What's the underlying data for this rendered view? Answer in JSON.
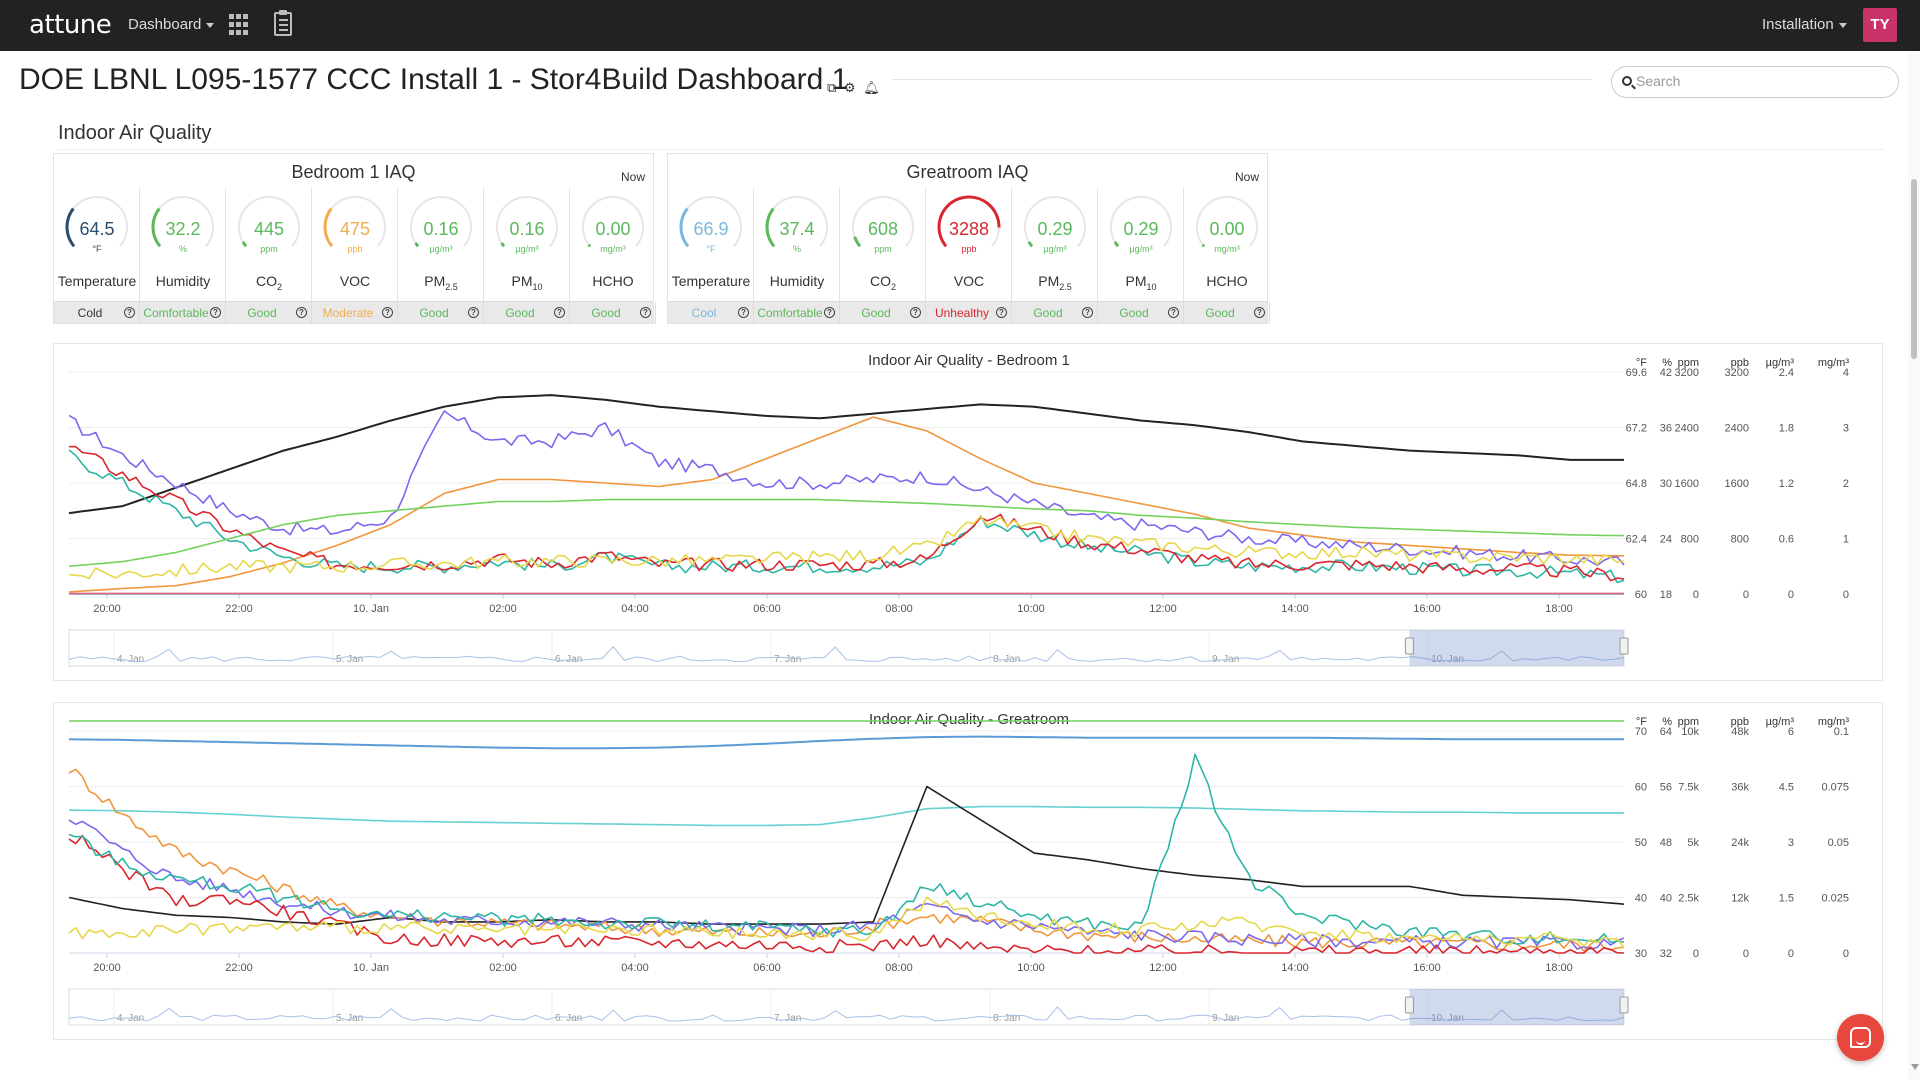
{
  "topbar": {
    "brand": "attune",
    "dashboard_menu": "Dashboard",
    "installation_menu": "Installation",
    "avatar_initials": "TY"
  },
  "page": {
    "title": "DOE LBNL L095-1577 CCC Install 1 - Stor4Build Dashboard 1",
    "search_placeholder": "Search",
    "section_title": "Indoor Air Quality"
  },
  "panels": [
    {
      "title": "Bedroom 1 IAQ",
      "now": "Now",
      "tiles": [
        {
          "value": "64.5",
          "unit": "°F",
          "label": "Temperature",
          "sub": "",
          "status": "Cold",
          "color": "#2c4d6c",
          "fraction": 0.3
        },
        {
          "value": "32.2",
          "unit": "%",
          "label": "Humidity",
          "sub": "",
          "status": "Comfortable",
          "color": "#5cb85c",
          "fraction": 0.3
        },
        {
          "value": "445",
          "unit": "ppm",
          "label": "CO",
          "sub": "2",
          "status": "Good",
          "color": "#5cb85c",
          "fraction": 0.04
        },
        {
          "value": "475",
          "unit": "ppb",
          "label": "VOC",
          "sub": "",
          "status": "Moderate",
          "color": "#f0ad4e",
          "fraction": 0.3
        },
        {
          "value": "0.16",
          "unit": "µg/m³",
          "label": "PM",
          "sub": "2.5",
          "status": "Good",
          "color": "#5cb85c",
          "fraction": 0.03
        },
        {
          "value": "0.16",
          "unit": "µg/m³",
          "label": "PM",
          "sub": "10",
          "status": "Good",
          "color": "#5cb85c",
          "fraction": 0.03
        },
        {
          "value": "0.00",
          "unit": "mg/m³",
          "label": "HCHO",
          "sub": "",
          "status": "Good",
          "color": "#5cb85c",
          "fraction": 0.0
        }
      ]
    },
    {
      "title": "Greatroom IAQ",
      "now": "Now",
      "tiles": [
        {
          "value": "66.9",
          "unit": "°F",
          "label": "Temperature",
          "sub": "",
          "status": "Cool",
          "color": "#7ab8dd",
          "fraction": 0.3
        },
        {
          "value": "37.4",
          "unit": "%",
          "label": "Humidity",
          "sub": "",
          "status": "Comfortable",
          "color": "#5cb85c",
          "fraction": 0.3
        },
        {
          "value": "608",
          "unit": "ppm",
          "label": "CO",
          "sub": "2",
          "status": "Good",
          "color": "#5cb85c",
          "fraction": 0.08
        },
        {
          "value": "3288",
          "unit": "ppb",
          "label": "VOC",
          "sub": "",
          "status": "Unhealthy",
          "color": "#d9262f",
          "fraction": 0.85
        },
        {
          "value": "0.29",
          "unit": "µg/m³",
          "label": "PM",
          "sub": "2.5",
          "status": "Good",
          "color": "#5cb85c",
          "fraction": 0.04
        },
        {
          "value": "0.29",
          "unit": "µg/m³",
          "label": "PM",
          "sub": "10",
          "status": "Good",
          "color": "#5cb85c",
          "fraction": 0.04
        },
        {
          "value": "0.00",
          "unit": "mg/m³",
          "label": "HCHO",
          "sub": "",
          "status": "Good",
          "color": "#5cb85c",
          "fraction": 0.0
        }
      ]
    }
  ],
  "chart_data": [
    {
      "type": "line",
      "title": "Indoor Air Quality - Bedroom 1",
      "x_ticks": [
        "20:00",
        "22:00",
        "10. Jan",
        "02:00",
        "04:00",
        "06:00",
        "08:00",
        "10:00",
        "12:00",
        "14:00",
        "16:00",
        "18:00"
      ],
      "navigator_ticks": [
        "4. Jan",
        "5. Jan",
        "6. Jan",
        "7. Jan",
        "8. Jan",
        "9. Jan",
        "10. Jan"
      ],
      "axes": [
        {
          "unit": "°F",
          "ticks": [
            "69.6",
            "67.2",
            "64.8",
            "62.4",
            "60"
          ]
        },
        {
          "unit": "%",
          "ticks": [
            "42",
            "36",
            "30",
            "24",
            "18"
          ]
        },
        {
          "unit": "ppm",
          "ticks": [
            "3200",
            "2400",
            "1600",
            "800",
            "0"
          ]
        },
        {
          "unit": "ppb",
          "ticks": [
            "3200",
            "2400",
            "1600",
            "800",
            "0"
          ]
        },
        {
          "unit": "µg/m³",
          "ticks": [
            "2.4",
            "1.8",
            "1.2",
            "0.6",
            "0"
          ]
        },
        {
          "unit": "mg/m³",
          "ticks": [
            "4",
            "3",
            "2",
            "1",
            "0"
          ]
        }
      ],
      "series": [
        {
          "color": "#222222",
          "values": [
            63.5,
            63.8,
            64.6,
            65.4,
            66.2,
            66.8,
            67.5,
            68.1,
            68.5,
            68.6,
            68.4,
            68.1,
            67.9,
            67.7,
            67.6,
            67.8,
            68.0,
            68.2,
            68.1,
            67.8,
            67.5,
            67.3,
            67.0,
            66.6,
            66.4,
            66.2,
            66.1,
            66.0,
            65.8,
            65.8
          ]
        },
        {
          "color": "#5b9bd5",
          "values": [
            27.5,
            27.7,
            28.0,
            28.4,
            28.8,
            29.2,
            29.5,
            29.8,
            29.9,
            29.8,
            29.7,
            29.6,
            29.4,
            29.3,
            29.5,
            30.0,
            30.5,
            31.5,
            33.0,
            34.5,
            34.0,
            33.4,
            32.8,
            32.8,
            32.7,
            32.2,
            31.7,
            31.1,
            30.5,
            30.3
          ]
        },
        {
          "color": "#f0963c",
          "values": [
            30,
            80,
            120,
            250,
            450,
            700,
            1000,
            1450,
            1650,
            1650,
            1600,
            1550,
            1650,
            1950,
            2250,
            2550,
            2350,
            1950,
            1600,
            1450,
            1300,
            1150,
            950,
            850,
            750,
            700,
            650,
            600,
            560,
            550
          ]
        },
        {
          "color": "#7b68ee",
          "values": [
            2500,
            2000,
            1600,
            1200,
            950,
            900,
            1100,
            2600,
            2200,
            2200,
            2400,
            1900,
            1800,
            1600,
            1600,
            1650,
            1700,
            1500,
            1300,
            1100,
            1000,
            900,
            800,
            750,
            700,
            650,
            600,
            550,
            500,
            450
          ]
        },
        {
          "color": "#2db6a6",
          "values": [
            1.5,
            1.2,
            0.9,
            0.6,
            0.4,
            0.3,
            0.3,
            0.3,
            0.35,
            0.3,
            0.4,
            0.3,
            0.3,
            0.3,
            0.3,
            0.3,
            0.35,
            0.8,
            0.65,
            0.5,
            0.45,
            0.35,
            0.3,
            0.3,
            0.3,
            0.28,
            0.25,
            0.25,
            0.22,
            0.18
          ]
        },
        {
          "color": "#d9262f",
          "values": [
            1.6,
            1.3,
            1.0,
            0.7,
            0.45,
            0.32,
            0.32,
            0.33,
            0.38,
            0.33,
            0.42,
            0.32,
            0.32,
            0.32,
            0.32,
            0.32,
            0.38,
            0.85,
            0.7,
            0.55,
            0.48,
            0.38,
            0.32,
            0.32,
            0.32,
            0.3,
            0.27,
            0.27,
            0.24,
            0.2
          ]
        },
        {
          "color": "#e6d84a",
          "values": [
            0.2,
            0.22,
            0.25,
            0.3,
            0.3,
            0.3,
            0.32,
            0.33,
            0.35,
            0.36,
            0.36,
            0.36,
            0.36,
            0.38,
            0.4,
            0.42,
            0.5,
            0.8,
            0.7,
            0.6,
            0.55,
            0.5,
            0.45,
            0.45,
            0.45,
            0.42,
            0.4,
            0.4,
            0.38,
            0.36
          ]
        },
        {
          "color": "#72d35c",
          "values": [
            0.3,
            0.35,
            0.45,
            0.6,
            0.75,
            0.85,
            0.9,
            0.95,
            1.0,
            1.0,
            1.02,
            1.02,
            1.02,
            1.02,
            1.02,
            1.0,
            0.98,
            0.95,
            0.92,
            0.9,
            0.85,
            0.82,
            0.78,
            0.75,
            0.72,
            0.7,
            0.68,
            0.66,
            0.64,
            0.63
          ]
        },
        {
          "color": "#e0667a",
          "values": [
            0.01,
            0.01,
            0.01,
            0.01,
            0.01,
            0.01,
            0.01,
            0.01,
            0.01,
            0.01,
            0.01,
            0.01,
            0.01,
            0.01,
            0.01,
            0.01,
            0.01,
            0.01,
            0.01,
            0.01,
            0.01,
            0.01,
            0.01,
            0.01,
            0.01,
            0.01,
            0.01,
            0.01,
            0.01,
            0.01
          ]
        }
      ]
    },
    {
      "type": "line",
      "title": "Indoor Air Quality - Greatroom",
      "x_ticks": [
        "20:00",
        "22:00",
        "10. Jan",
        "02:00",
        "04:00",
        "06:00",
        "08:00",
        "10:00",
        "12:00",
        "14:00",
        "16:00",
        "18:00"
      ],
      "navigator_ticks": [
        "4. Jan",
        "5. Jan",
        "6. Jan",
        "7. Jan",
        "8. Jan",
        "9. Jan",
        "10. Jan"
      ],
      "axes": [
        {
          "unit": "°F",
          "ticks": [
            "70",
            "60",
            "50",
            "40",
            "30"
          ]
        },
        {
          "unit": "%",
          "ticks": [
            "64",
            "56",
            "48",
            "40",
            "32"
          ]
        },
        {
          "unit": "ppm",
          "ticks": [
            "10k",
            "7.5k",
            "5k",
            "2.5k",
            "0"
          ]
        },
        {
          "unit": "ppb",
          "ticks": [
            "48k",
            "36k",
            "24k",
            "12k",
            "0"
          ]
        },
        {
          "unit": "µg/m³",
          "ticks": [
            "6",
            "4.5",
            "3",
            "1.5",
            "0"
          ]
        },
        {
          "unit": "mg/m³",
          "ticks": [
            "0.1",
            "0.075",
            "0.05",
            "0.025",
            "0"
          ]
        }
      ],
      "series": [
        {
          "color": "#5b9bd5",
          "values": [
            68.5,
            68.4,
            68.2,
            68.0,
            67.8,
            67.6,
            67.4,
            67.2,
            67.0,
            66.9,
            66.9,
            67.0,
            67.3,
            67.7,
            68.2,
            68.6,
            68.9,
            69.0,
            68.9,
            68.8,
            68.8,
            68.8,
            68.8,
            68.8,
            68.7,
            68.6,
            68.5,
            68.5,
            68.5,
            68.5
          ]
        },
        {
          "color": "#67d1d1",
          "values": [
            52.6,
            52.5,
            52.3,
            52.0,
            51.6,
            51.3,
            51.0,
            50.9,
            50.8,
            50.7,
            50.6,
            50.5,
            50.4,
            50.4,
            50.5,
            51.5,
            52.8,
            53.1,
            53.1,
            53.0,
            53.0,
            52.9,
            52.7,
            52.5,
            52.4,
            52.3,
            52.3,
            52.2,
            52.2,
            52.2
          ]
        },
        {
          "color": "#222222",
          "values": [
            2500,
            2000,
            1700,
            1600,
            1400,
            1300,
            1600,
            1400,
            1400,
            1500,
            1400,
            1400,
            1300,
            1300,
            1300,
            1400,
            7500,
            6000,
            4500,
            4200,
            3800,
            3500,
            3300,
            3000,
            3000,
            3000,
            2600,
            2500,
            2400,
            2200
          ]
        },
        {
          "color": "#f0963c",
          "values": [
            40000,
            30000,
            22000,
            18000,
            14000,
            10000,
            8000,
            7000,
            6500,
            6000,
            5500,
            5000,
            4500,
            4200,
            4000,
            6000,
            8000,
            7000,
            5000,
            4000,
            3500,
            3000,
            2600,
            2400,
            2200,
            2100,
            2000,
            1900,
            1800,
            1700
          ]
        },
        {
          "color": "#7b68ee",
          "values": [
            30000,
            22000,
            16000,
            14000,
            11000,
            9000,
            8000,
            7000,
            7000,
            6800,
            6500,
            6000,
            5500,
            5200,
            5000,
            6000,
            10000,
            7000,
            6000,
            4500,
            4000,
            3500,
            3000,
            2800,
            2600,
            2400,
            2300,
            2200,
            2100,
            2000
          ]
        },
        {
          "color": "#d9262f",
          "values": [
            26000,
            18000,
            11000,
            12000,
            9000,
            6000,
            3000,
            2800,
            2600,
            2500,
            2400,
            2300,
            2000,
            1800,
            1500,
            1600,
            3000,
            1000,
            500,
            300,
            300,
            300,
            300,
            300,
            300,
            300,
            300,
            300,
            300,
            300
          ]
        },
        {
          "color": "#2db6a6",
          "values": [
            3.2,
            2.4,
            2.0,
            1.8,
            1.5,
            1.2,
            1.0,
            1.0,
            0.9,
            0.9,
            0.8,
            0.8,
            0.7,
            0.7,
            0.6,
            0.6,
            1.8,
            1.4,
            1.0,
            0.8,
            0.7,
            5.2,
            2.0,
            1.0,
            0.8,
            0.6,
            0.5,
            0.4,
            0.4,
            0.35
          ]
        },
        {
          "color": "#e6d84a",
          "values": [
            0.5,
            0.6,
            0.6,
            0.7,
            0.7,
            0.7,
            0.7,
            0.6,
            0.6,
            0.6,
            0.6,
            0.6,
            0.55,
            0.5,
            0.5,
            0.5,
            1.4,
            1.0,
            0.8,
            0.7,
            0.6,
            0.8,
            0.8,
            0.6,
            0.5,
            0.4,
            0.4,
            0.4,
            0.35,
            0.3
          ]
        },
        {
          "color": "#72d35c",
          "values": [
            0.4,
            0.4,
            0.4,
            0.4,
            0.4,
            0.4,
            0.4,
            0.4,
            0.4,
            0.4,
            0.4,
            0.4,
            0.4,
            0.4,
            0.4,
            0.4,
            0.4,
            0.4,
            0.4,
            0.4,
            0.4,
            0.4,
            0.4,
            0.4,
            0.4,
            0.4,
            0.4,
            0.4,
            0.4,
            0.4
          ]
        }
      ]
    }
  ]
}
